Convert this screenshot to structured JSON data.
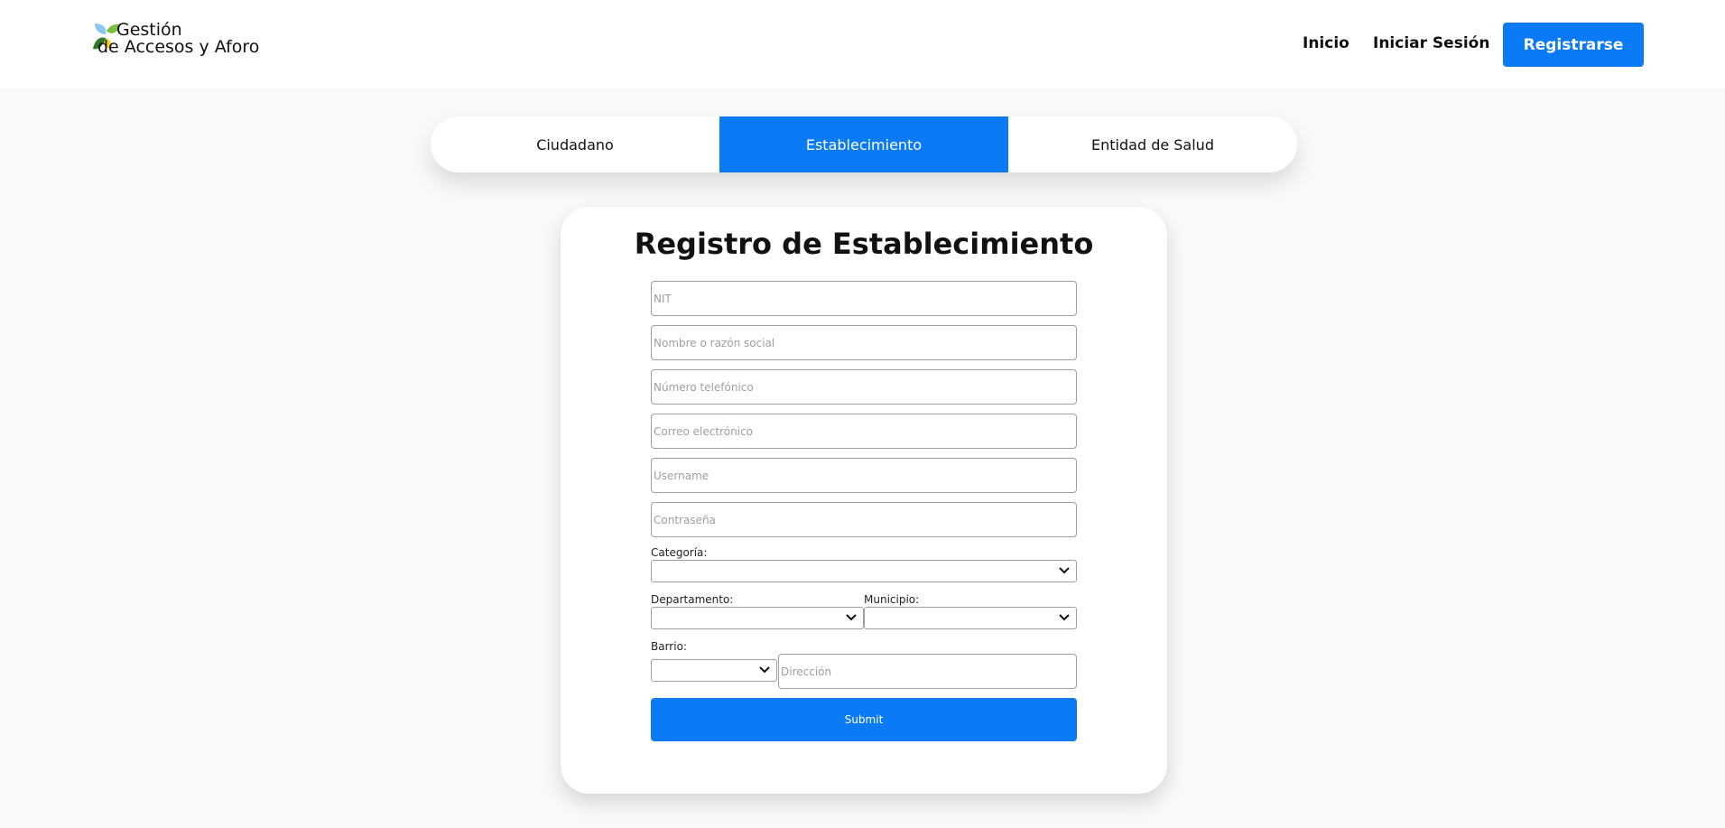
{
  "brand": {
    "line1": "Gestión",
    "line2": "de Accesos y Aforo",
    "logo_icon": "leaf-logo-icon"
  },
  "nav": {
    "home": "Inicio",
    "login": "Iniciar Sesión",
    "register": "Registrarse"
  },
  "tabs": [
    {
      "label": "Ciudadano",
      "active": false
    },
    {
      "label": "Establecimiento",
      "active": true
    },
    {
      "label": "Entidad de Salud",
      "active": false
    }
  ],
  "form": {
    "title": "Registro de Establecimiento",
    "fields": {
      "nit": {
        "placeholder": "NIT",
        "value": ""
      },
      "name": {
        "placeholder": "Nombre o razón social",
        "value": ""
      },
      "phone": {
        "placeholder": "Número telefónico",
        "value": ""
      },
      "email": {
        "placeholder": "Correo electrónico",
        "value": ""
      },
      "username": {
        "placeholder": "Username",
        "value": ""
      },
      "password": {
        "placeholder": "Contraseña",
        "value": ""
      },
      "address": {
        "placeholder": "Dirección",
        "value": ""
      }
    },
    "labels": {
      "category": "Categoría:",
      "department": "Departamento:",
      "municipality": "Municipio:",
      "neighborhood": "Barrio:"
    },
    "selects": {
      "category": "",
      "department": "",
      "municipality": "",
      "neighborhood": ""
    },
    "submit": "Submit"
  },
  "colors": {
    "accent": "#0a7af7",
    "background": "#f8f9fb",
    "card": "#ffffff"
  }
}
